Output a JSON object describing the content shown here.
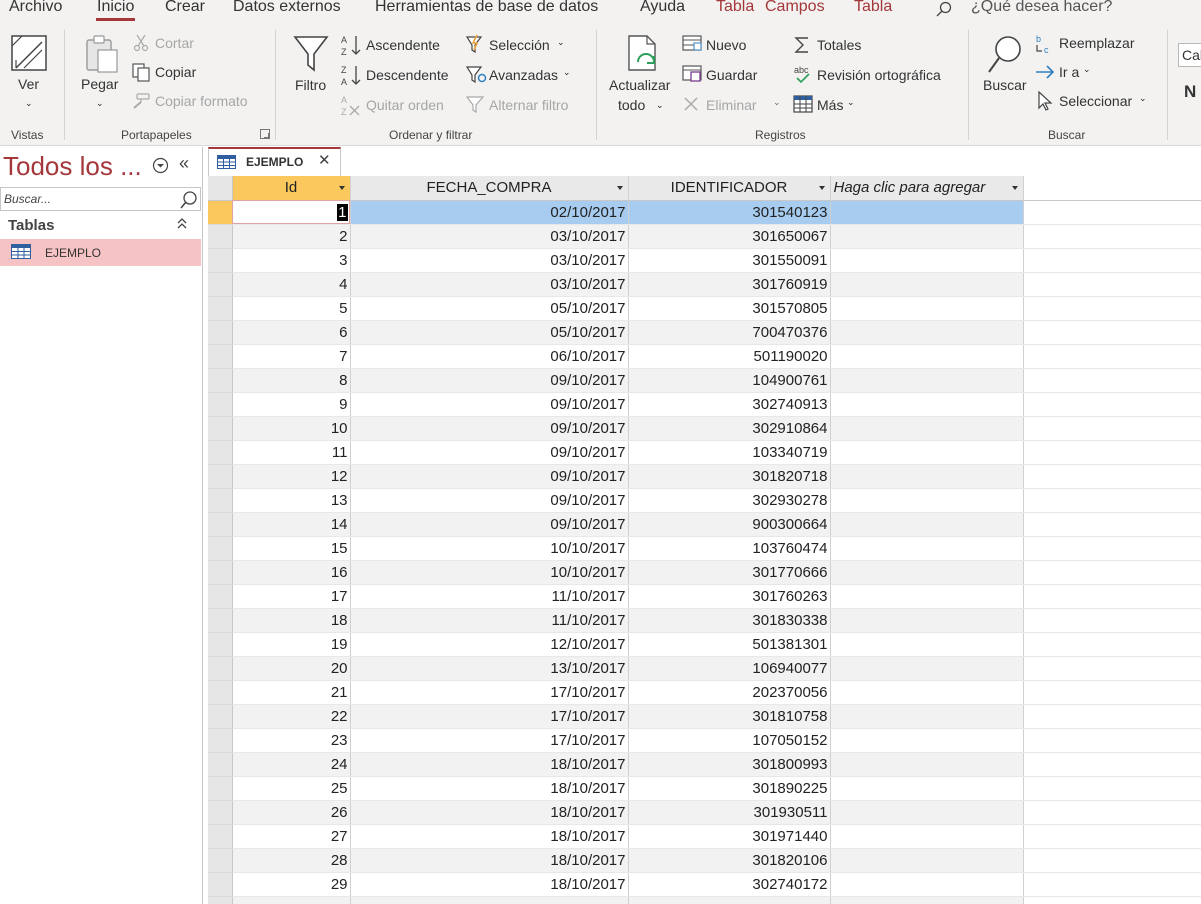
{
  "menu": {
    "tabs": [
      {
        "label": "Archivo",
        "key": "archivo"
      },
      {
        "label": "Inicio",
        "key": "inicio"
      },
      {
        "label": "Crear",
        "key": "crear"
      },
      {
        "label": "Datos externos",
        "key": "datos"
      },
      {
        "label": "Herramientas de base de datos",
        "key": "herr"
      },
      {
        "label": "Ayuda",
        "key": "ayuda"
      },
      {
        "label": "Tabla",
        "key": "tabla1"
      },
      {
        "label": "Campos",
        "key": "campos"
      },
      {
        "label": "Tabla",
        "key": "tabla2"
      }
    ],
    "tell_me": "¿Qué desea hacer?"
  },
  "ribbon": {
    "vistas": {
      "group": "Vistas",
      "ver": "Ver"
    },
    "portapapeles": {
      "group": "Portapapeles",
      "pegar": "Pegar",
      "cortar": "Cortar",
      "copiar": "Copiar",
      "copiar_formato": "Copiar formato"
    },
    "ordenar": {
      "group": "Ordenar y filtrar",
      "filtro": "Filtro",
      "ascendente": "Ascendente",
      "descendente": "Descendente",
      "quitar_orden": "Quitar orden",
      "seleccion": "Selección",
      "avanzadas": "Avanzadas",
      "alternar_filtro": "Alternar filtro"
    },
    "registros": {
      "group": "Registros",
      "actualizar": "Actualizar",
      "todo": "todo",
      "nuevo": "Nuevo",
      "guardar": "Guardar",
      "eliminar": "Eliminar",
      "totales": "Totales",
      "revision": "Revisión ortográfica",
      "mas": "Más"
    },
    "buscar": {
      "group": "Buscar",
      "buscar": "Buscar",
      "reemplazar": "Reemplazar",
      "ir_a": "Ir a",
      "seleccionar": "Seleccionar"
    },
    "font_name": "Cal",
    "bold_glyph": "N"
  },
  "nav": {
    "title": "Todos los ...",
    "collapse_glyph": "«",
    "search_placeholder": "Buscar...",
    "group": "Tablas",
    "items": [
      {
        "label": "EJEMPLO"
      }
    ]
  },
  "doc_tab": {
    "label": "EJEMPLO",
    "close": "✕"
  },
  "table": {
    "columns": [
      "Id",
      "FECHA_COMPRA",
      "IDENTIFICADOR",
      "Haga clic para agregar"
    ],
    "rows": [
      [
        "1",
        "02/10/2017",
        "301540123"
      ],
      [
        "2",
        "03/10/2017",
        "301650067"
      ],
      [
        "3",
        "03/10/2017",
        "301550091"
      ],
      [
        "4",
        "03/10/2017",
        "301760919"
      ],
      [
        "5",
        "05/10/2017",
        "301570805"
      ],
      [
        "6",
        "05/10/2017",
        "700470376"
      ],
      [
        "7",
        "06/10/2017",
        "501190020"
      ],
      [
        "8",
        "09/10/2017",
        "104900761"
      ],
      [
        "9",
        "09/10/2017",
        "302740913"
      ],
      [
        "10",
        "09/10/2017",
        "302910864"
      ],
      [
        "11",
        "09/10/2017",
        "103340719"
      ],
      [
        "12",
        "09/10/2017",
        "301820718"
      ],
      [
        "13",
        "09/10/2017",
        "302930278"
      ],
      [
        "14",
        "09/10/2017",
        "900300664"
      ],
      [
        "15",
        "10/10/2017",
        "103760474"
      ],
      [
        "16",
        "10/10/2017",
        "301770666"
      ],
      [
        "17",
        "11/10/2017",
        "301760263"
      ],
      [
        "18",
        "11/10/2017",
        "301830338"
      ],
      [
        "19",
        "12/10/2017",
        "501381301"
      ],
      [
        "20",
        "13/10/2017",
        "106940077"
      ],
      [
        "21",
        "17/10/2017",
        "202370056"
      ],
      [
        "22",
        "17/10/2017",
        "301810758"
      ],
      [
        "23",
        "17/10/2017",
        "107050152"
      ],
      [
        "24",
        "18/10/2017",
        "301800993"
      ],
      [
        "25",
        "18/10/2017",
        "301890225"
      ],
      [
        "26",
        "18/10/2017",
        "301930511"
      ],
      [
        "27",
        "18/10/2017",
        "301971440"
      ],
      [
        "28",
        "18/10/2017",
        "301820106"
      ],
      [
        "29",
        "18/10/2017",
        "302740172"
      ]
    ],
    "active_row": 0
  },
  "colors": {
    "accent": "#a4373a",
    "selected_row": "#a7ccef",
    "current_indicator": "#fbc85d",
    "nav_selected": "#f6c3c4"
  }
}
